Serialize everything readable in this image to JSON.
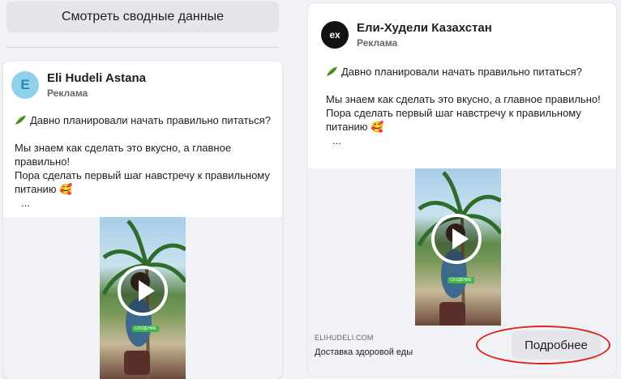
{
  "summary_button": {
    "label": "Смотреть сводные данные"
  },
  "left_ad": {
    "page_name": "Eli Hudeli Astana",
    "avatar_letter": "E",
    "sponsored": "Реклама",
    "line1": "Давно планировали начать правильно питаться?",
    "line2": "Мы знаем как сделать это вкусно, а главное правильно!",
    "line3": "Пора сделать первый шаг навстречу к правильному питанию 🥰",
    "ellipsis": "...",
    "video_tag": "СХУДЕНИЕ"
  },
  "right_ad": {
    "page_name": "Ели-Худели Казахстан",
    "avatar_text": "ex",
    "sponsored": "Реклама",
    "line1": "Давно планировали начать правильно питаться?",
    "line2": "Мы знаем как сделать это вкусно, а главное правильно!",
    "line3": "Пора сделать первый шаг навстречу к правильному питанию 🥰",
    "ellipsis": "...",
    "video_tag": "СХУДЕНИЕ",
    "link_domain": "ELIHUDELI.COM",
    "link_title": "Доставка здоровой еды",
    "cta_label": "Подробнее"
  },
  "colors": {
    "highlight_oval": "#e0201c",
    "avatar_left": "#8fd0ea",
    "avatar_right": "#111111"
  },
  "icons": [
    "leaf-icon",
    "play-icon"
  ]
}
